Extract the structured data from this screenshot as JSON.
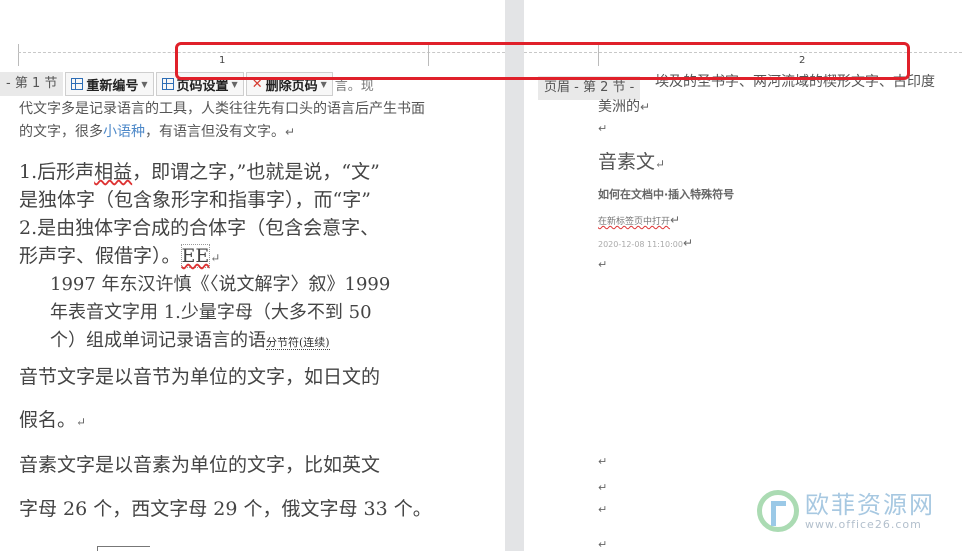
{
  "left_page": {
    "page_number": "1",
    "header_label": "- 第 1 节",
    "toolbar": {
      "renumber_label": "重新编号",
      "page_setup_label": "页码设置",
      "delete_label": "删除页码",
      "trailing_text": "言。现"
    },
    "lines": {
      "l1": "代文字多是记录语言的工具，人类往往先有口头的语言后产生书面",
      "l2_a": "的文字，很多",
      "l2_b": "小语种",
      "l2_c": "，有语言但没有文字。",
      "l3_a": "1.后形声",
      "l3_b": "相益",
      "l3_c": "，即谓之字，”也就是说，“文”",
      "l4": "是独体字（包含象形字和指事字），而“字”",
      "l5": "2.是由独体字合成的合体字（包含会意字、",
      "l6_a": "形声字、假借字）。",
      "l6_b": "EE",
      "l7_a": "1997 年东汉许慎《〈说文解字〉叙》",
      "l7_b": "1999",
      "l8": "年表音文字用 1.少量字母（大多不到 50",
      "l9": "个）组成单词记录语言的语",
      "section_break": "分节符(连续)",
      "l10": "音节文字是以音节为单位的文字，如日文的",
      "l11": "假名。",
      "l12": "音素文字是以音素为单位的文字，比如英文",
      "l13": "字母 26 个，西文字母 29 个，俄文字母 33 个。"
    }
  },
  "right_page": {
    "page_number": "2",
    "header_label": "页眉 - 第 2 节 -",
    "top_text": "埃及的圣书字、两河流域的楔形文字、古印度",
    "top_text2": "美洲的",
    "heading": "音素文",
    "subheading": "如何在文档中·插入特殊符号",
    "meta": "在新标签页中打开",
    "date": "2020-12-08 11:10:00"
  },
  "watermark": {
    "cn": "欧菲资源网",
    "url": "www.office26.com"
  },
  "para_mark": "↵",
  "colors": {
    "highlight": "#e0202a",
    "gutter": "#e3e4e6",
    "icon_blue": "#2d6db5",
    "delete_red": "#d63b2f"
  }
}
